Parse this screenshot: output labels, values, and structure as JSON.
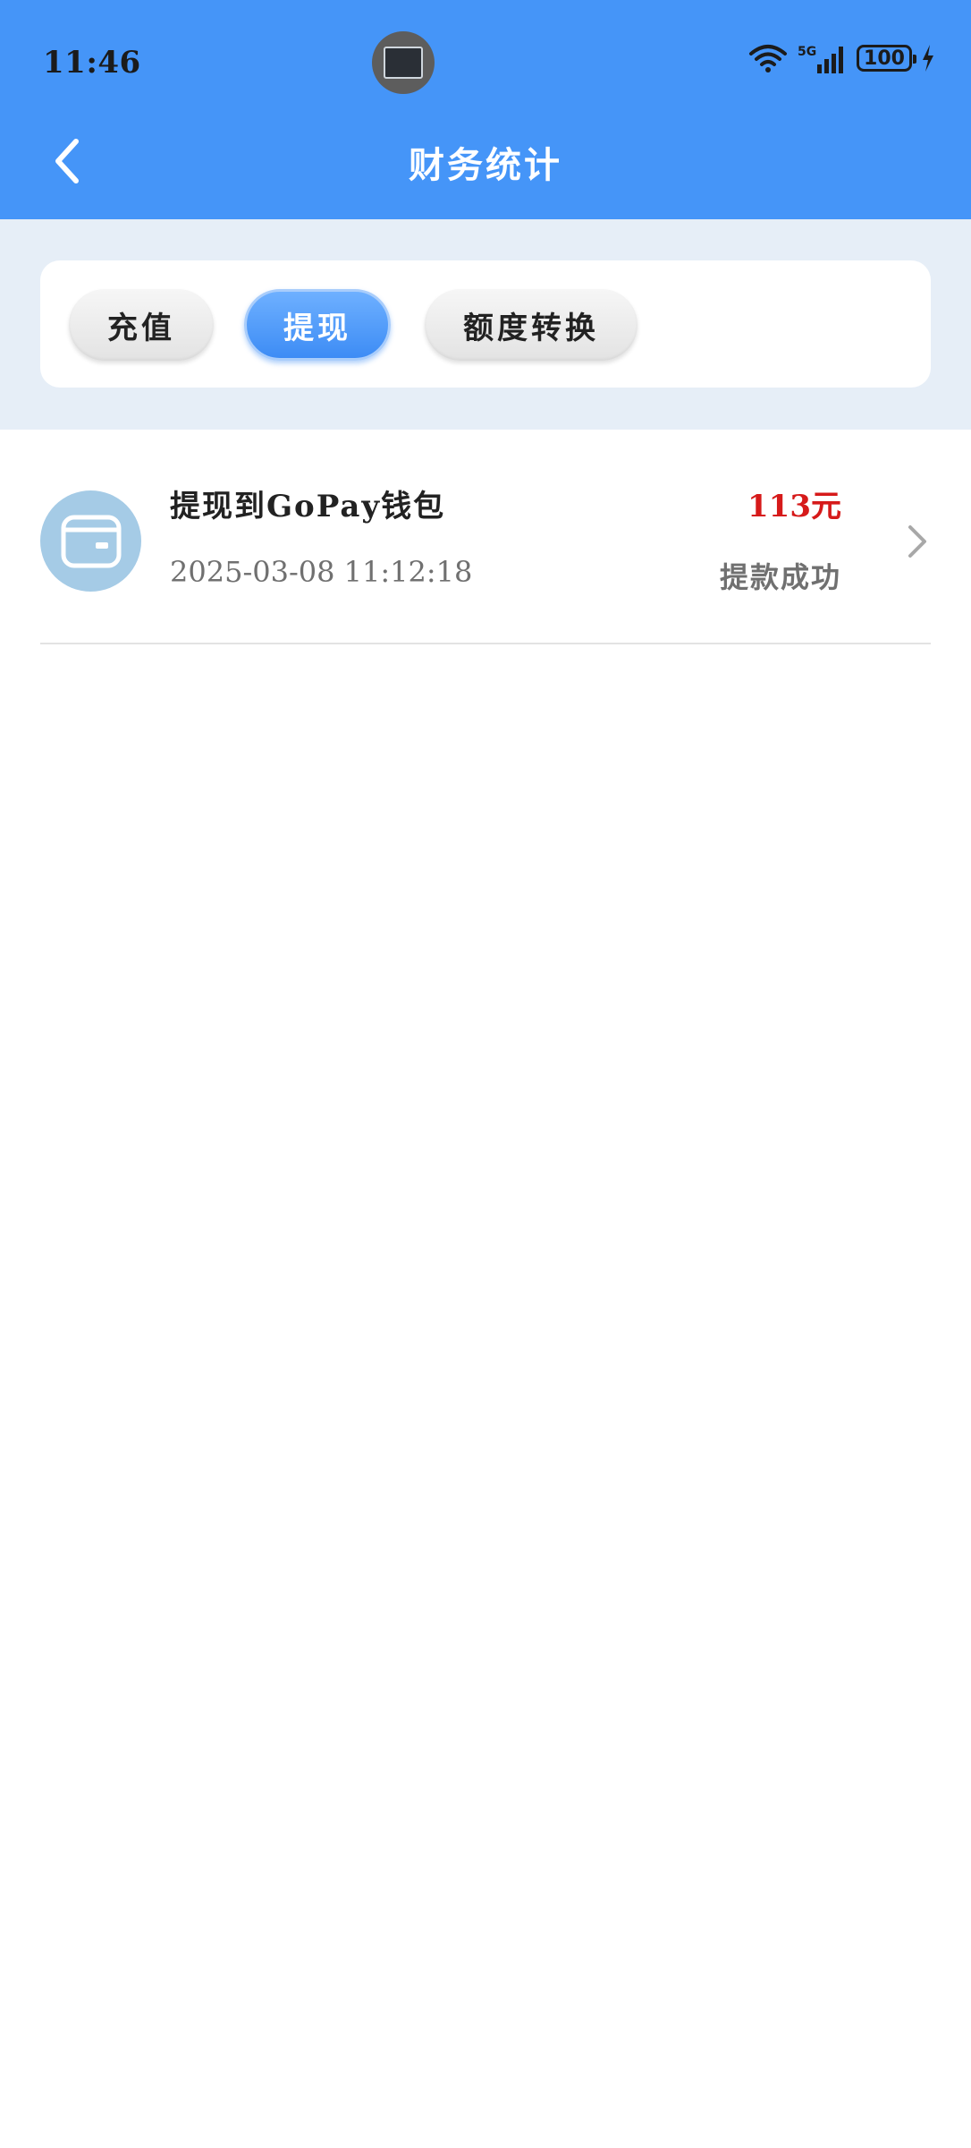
{
  "status_bar": {
    "time": "11:46",
    "battery": "100",
    "network": "5G"
  },
  "nav": {
    "title": "财务统计",
    "back_icon": "chevron-left-icon"
  },
  "tabs": [
    {
      "label": "充值",
      "active": false
    },
    {
      "label": "提现",
      "active": true
    },
    {
      "label": "额度转换",
      "active": false
    }
  ],
  "records": [
    {
      "icon": "wallet-icon",
      "title": "提现到GoPay钱包",
      "time": "2025-03-08 11:12:18",
      "amount": "113元",
      "status": "提款成功"
    }
  ],
  "colors": {
    "primary": "#4595F8",
    "section_bg": "#E6EEF7",
    "amount": "#D61A1A",
    "avatar_bg": "#A5CBE6"
  }
}
